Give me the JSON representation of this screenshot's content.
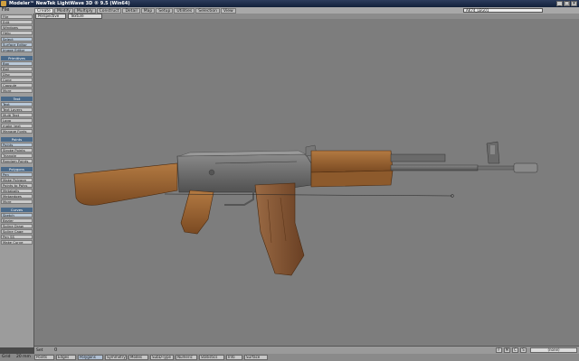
{
  "window": {
    "title": "Modeler™ NewTek LightWave 3D ® 9.5 (Win64)"
  },
  "menu": {
    "file": "File",
    "layer_name": "AK74_LEG01"
  },
  "tabs": [
    "Create",
    "Modify",
    "Multiply",
    "Construct",
    "Detail",
    "Map",
    "Setup",
    "Utilities",
    "Selection",
    "View"
  ],
  "active_tab": "Create",
  "toolbox": {
    "top_items": [
      "File",
      "Edit",
      "Windows",
      "Help"
    ],
    "select": "Select",
    "editors": [
      "Surface Editor",
      "Image Editor"
    ],
    "sections": [
      {
        "head": "Primitives",
        "items": [
          "Box",
          "Ball",
          "Disc",
          "Cone",
          "Capsule",
          "More"
        ]
      },
      {
        "head": "Text",
        "items": [
          "Text",
          "Text Layers",
          "Multi Text",
          "Logo",
          "make_text",
          "Manage Fonts"
        ]
      },
      {
        "head": "Points",
        "items": [
          "Points",
          "Stroke Points",
          "Triangle",
          "Random Points"
        ]
      },
      {
        "head": "Polygons",
        "items": [
          "Pen",
          "Make Polygon",
          "Points to Polys",
          "Metaballs",
          "Metaedges",
          "More"
        ]
      },
      {
        "head": "Curves",
        "items": [
          "Sketch",
          "Bezier",
          "Spline Draw",
          "Spline Cage",
          "Pen SS",
          "Make Curve"
        ]
      }
    ]
  },
  "viewbar": {
    "view_mode": "Perspective",
    "shading": "Texture"
  },
  "status": {
    "set_label": "Set",
    "value": "0",
    "zoom_buttons": [
      "F",
      "M",
      "C",
      "S"
    ],
    "layer_mode": "(none)"
  },
  "bottom": {
    "grid_label": "Grid",
    "grid_value": "20 mm",
    "items": [
      "Points",
      "Edges",
      "Polygons",
      "Symmetry",
      "Modes",
      "SubD-Type",
      "Numeric",
      "Statistics",
      "Info",
      "Surface"
    ],
    "active_item": "Polygons"
  },
  "colors": {
    "viewport": "#7d7d7d",
    "wood": "#9b6432",
    "metal": "#6a6a6a",
    "magazine": "#8a5a3a"
  }
}
